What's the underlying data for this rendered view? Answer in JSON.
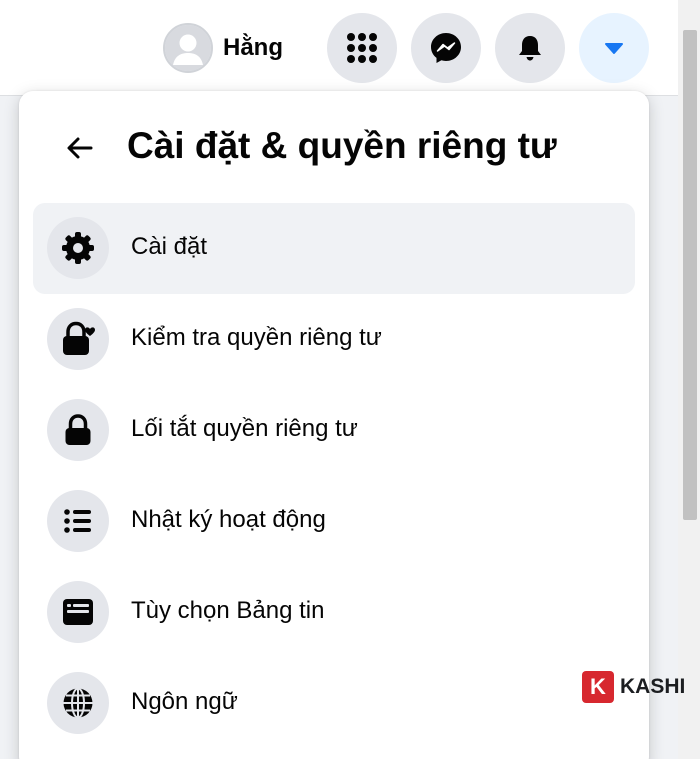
{
  "topbar": {
    "profile_name": "Hằng",
    "buttons": [
      {
        "name": "menu-grid",
        "icon": "grid-icon"
      },
      {
        "name": "messenger",
        "icon": "messenger-icon"
      },
      {
        "name": "notifications",
        "icon": "bell-icon"
      },
      {
        "name": "account",
        "icon": "caret-down-icon",
        "active": true
      }
    ]
  },
  "panel": {
    "title": "Cài đặt & quyền riêng tư",
    "back_icon": "arrow-left-icon",
    "items": [
      {
        "label": "Cài đặt",
        "icon": "gear-icon",
        "highlighted": true
      },
      {
        "label": "Kiểm tra quyền riêng tư",
        "icon": "lock-heart-icon"
      },
      {
        "label": "Lối tắt quyền riêng tư",
        "icon": "lock-icon"
      },
      {
        "label": "Nhật ký hoạt động",
        "icon": "list-icon"
      },
      {
        "label": "Tùy chọn Bảng tin",
        "icon": "feed-icon"
      },
      {
        "label": "Ngôn ngữ",
        "icon": "globe-icon"
      }
    ]
  },
  "watermark": {
    "badge": "K",
    "text": "KASHI"
  },
  "colors": {
    "accent": "#1877f2",
    "icon_bg": "#e4e6eb",
    "hover_bg": "#f0f2f5",
    "watermark_red": "#d7282f"
  }
}
